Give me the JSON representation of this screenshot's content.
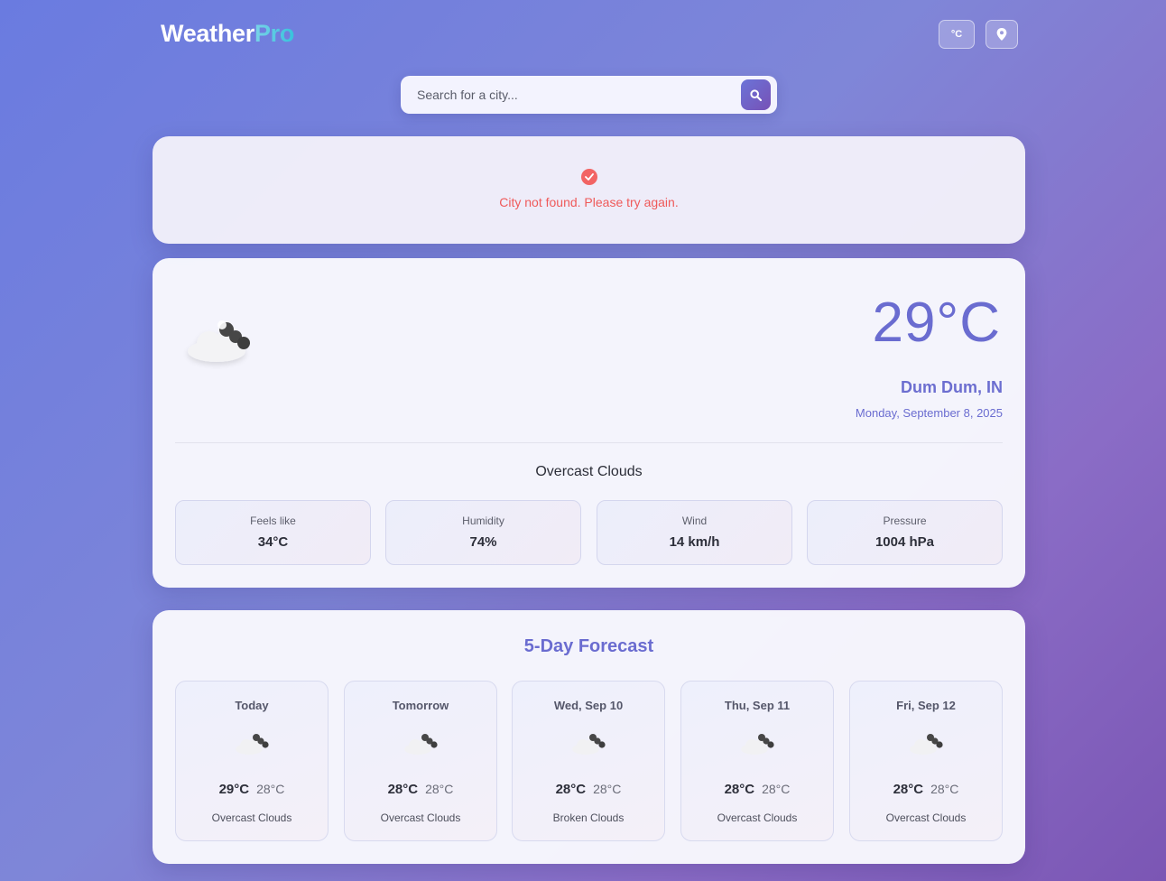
{
  "app": {
    "name_main": "Weather",
    "name_accent": "Pro"
  },
  "header": {
    "unit_label": "°C",
    "location_icon": "location-pin-icon"
  },
  "search": {
    "placeholder": "Search for a city...",
    "icon": "search-icon"
  },
  "error": {
    "message": "City not found. Please try again.",
    "icon": "check-circle-icon"
  },
  "current": {
    "icon": "overcast-clouds-icon",
    "temperature": "29°C",
    "city": "Dum Dum, IN",
    "date": "Monday, September 8, 2025",
    "description": "Overcast Clouds",
    "stats": [
      {
        "label": "Feels like",
        "value": "34°C"
      },
      {
        "label": "Humidity",
        "value": "74%"
      },
      {
        "label": "Wind",
        "value": "14 km/h"
      },
      {
        "label": "Pressure",
        "value": "1004 hPa"
      }
    ]
  },
  "forecast": {
    "title": "5-Day Forecast",
    "days": [
      {
        "day": "Today",
        "high": "29°C",
        "low": "28°C",
        "description": "Overcast Clouds"
      },
      {
        "day": "Tomorrow",
        "high": "28°C",
        "low": "28°C",
        "description": "Overcast Clouds"
      },
      {
        "day": "Wed, Sep 10",
        "high": "28°C",
        "low": "28°C",
        "description": "Broken Clouds"
      },
      {
        "day": "Thu, Sep 11",
        "high": "28°C",
        "low": "28°C",
        "description": "Overcast Clouds"
      },
      {
        "day": "Fri, Sep 12",
        "high": "28°C",
        "low": "28°C",
        "description": "Overcast Clouds"
      }
    ]
  },
  "colors": {
    "accent": "#6a6cd0",
    "error": "#ef5a5a",
    "logo_accent": "#38c2dc"
  }
}
